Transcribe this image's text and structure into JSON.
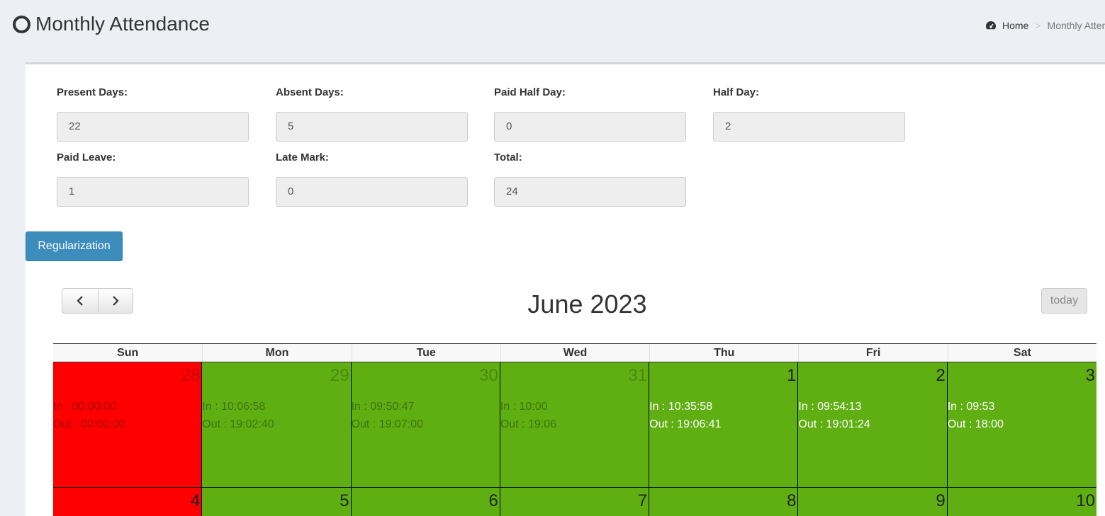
{
  "header": {
    "title": "Monthly Attendance"
  },
  "breadcrumb": {
    "home": "Home",
    "separator": ">",
    "current": "Monthly Attendance"
  },
  "stats": [
    {
      "label": "Present Days:",
      "value": "22"
    },
    {
      "label": "Absent Days:",
      "value": "5"
    },
    {
      "label": "Paid Half Day:",
      "value": "0"
    },
    {
      "label": "Half Day:",
      "value": "2"
    },
    {
      "label": "Paid Leave:",
      "value": "1"
    },
    {
      "label": "Late Mark:",
      "value": "0"
    },
    {
      "label": "Total:",
      "value": "24"
    }
  ],
  "actions": {
    "regularization": "Regularization"
  },
  "calendar": {
    "title": "June 2023",
    "today_label": "today",
    "weekdays": [
      "Sun",
      "Mon",
      "Tue",
      "Wed",
      "Thu",
      "Fri",
      "Sat"
    ],
    "status_colors": {
      "absent": "#ff0000",
      "present": "#5faf13"
    },
    "weeks": [
      [
        {
          "day": "28",
          "in": "In : 00:00:00",
          "out": "Out : 00:00:00",
          "status": "absent",
          "other_month": true
        },
        {
          "day": "29",
          "in": "In : 10:06:58",
          "out": "Out : 19:02:40",
          "status": "present",
          "other_month": true
        },
        {
          "day": "30",
          "in": "In : 09:50:47",
          "out": "Out : 19:07:00",
          "status": "present",
          "other_month": true
        },
        {
          "day": "31",
          "in": "In : 10:00",
          "out": "Out : 19:06",
          "status": "present",
          "other_month": true
        },
        {
          "day": "1",
          "in": "In : 10:35:58",
          "out": "Out : 19:06:41",
          "status": "present",
          "other_month": false
        },
        {
          "day": "2",
          "in": "In : 09:54:13",
          "out": "Out : 19:01:24",
          "status": "present",
          "other_month": false
        },
        {
          "day": "3",
          "in": "In : 09:53",
          "out": "Out : 18:00",
          "status": "present",
          "other_month": false
        }
      ],
      [
        {
          "day": "4",
          "status": "absent",
          "other_month": false
        },
        {
          "day": "5",
          "status": "present",
          "other_month": false
        },
        {
          "day": "6",
          "status": "present",
          "other_month": false
        },
        {
          "day": "7",
          "status": "present",
          "other_month": false
        },
        {
          "day": "8",
          "status": "present",
          "other_month": false
        },
        {
          "day": "9",
          "status": "present",
          "other_month": false
        },
        {
          "day": "10",
          "status": "present",
          "other_month": false
        }
      ]
    ]
  }
}
